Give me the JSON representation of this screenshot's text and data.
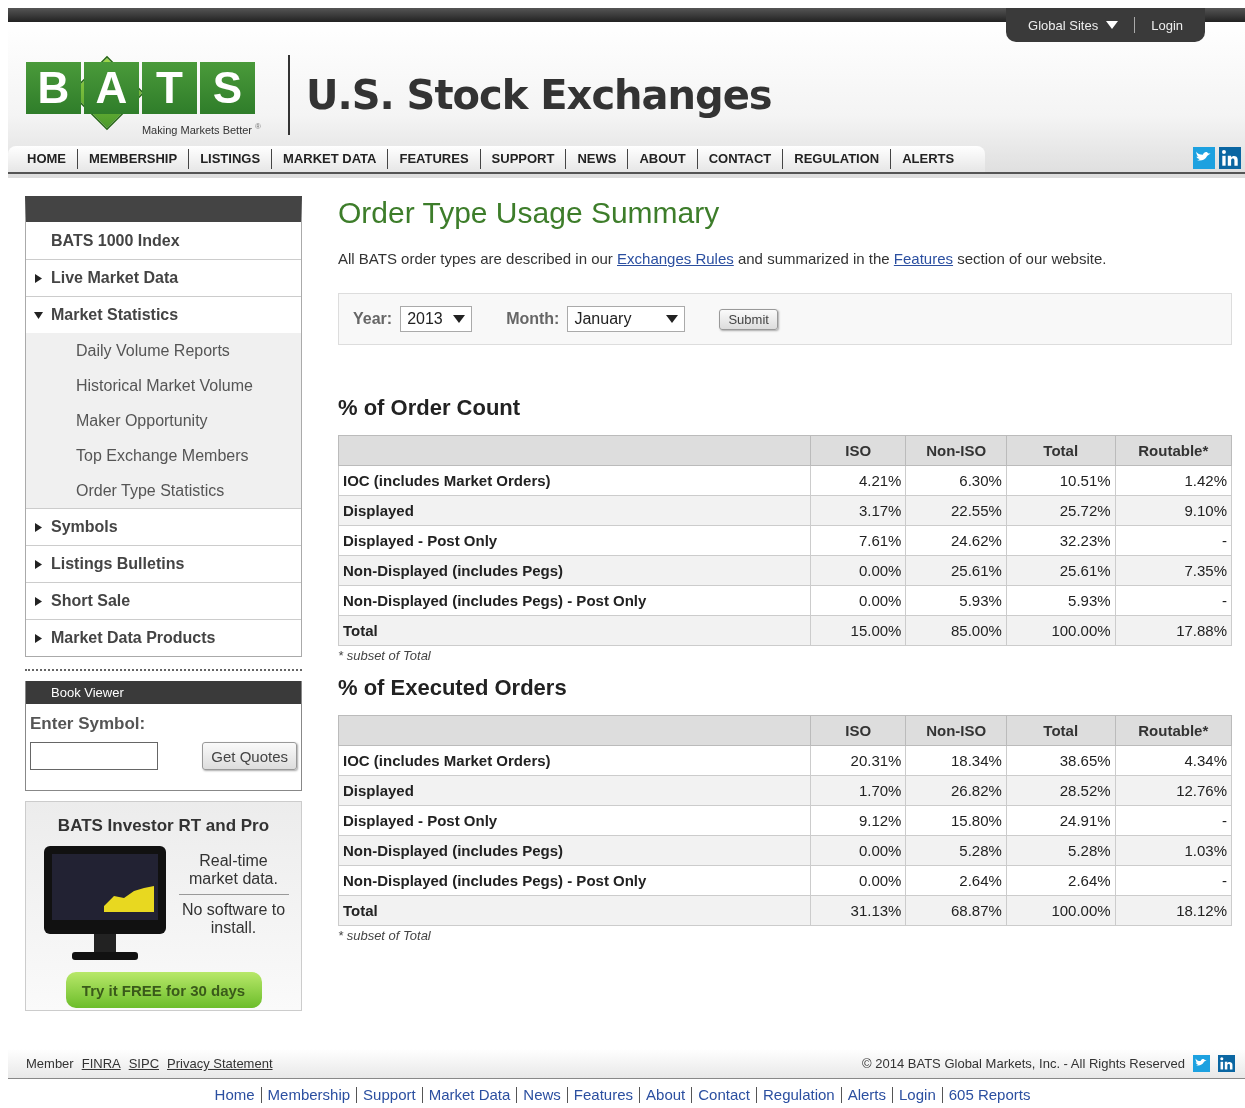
{
  "top_bar": {
    "links": [
      {
        "label": "Global Sites",
        "kind": "dropdown"
      },
      {
        "label": "Login",
        "kind": "link"
      }
    ]
  },
  "header": {
    "logo": {
      "letters": [
        "B",
        "A",
        "T",
        "S"
      ],
      "tagline": "Making Markets Better",
      "mark": "®"
    },
    "title": "U.S. Stock Exchanges"
  },
  "nav": {
    "items": [
      "HOME",
      "MEMBERSHIP",
      "LISTINGS",
      "MARKET DATA",
      "FEATURES",
      "SUPPORT",
      "NEWS",
      "ABOUT",
      "CONTACT",
      "REGULATION",
      "ALERTS"
    ]
  },
  "sidebar": {
    "items": [
      {
        "label": "BATS 1000 Index",
        "kind": "link"
      },
      {
        "label": "Live Market Data",
        "kind": "section",
        "expanded": false
      },
      {
        "label": "Market Statistics",
        "kind": "section",
        "expanded": true,
        "children": [
          {
            "label": "Daily Volume Reports"
          },
          {
            "label": "Historical Market Volume"
          },
          {
            "label": "Maker Opportunity"
          },
          {
            "label": "Top Exchange Members"
          },
          {
            "label": "Order Type Statistics"
          }
        ]
      },
      {
        "label": "Symbols",
        "kind": "section",
        "expanded": false
      },
      {
        "label": "Listings Bulletins",
        "kind": "section",
        "expanded": false
      },
      {
        "label": "Short Sale",
        "kind": "section",
        "expanded": false
      },
      {
        "label": "Market Data Products",
        "kind": "section",
        "expanded": false
      }
    ],
    "book_viewer": {
      "title": "Book Viewer",
      "label": "Enter Symbol:",
      "button": "Get Quotes"
    },
    "promo": {
      "title": "BATS Investor RT and Pro",
      "lines": [
        "Real-time market data.",
        "No software to install."
      ],
      "button": "Try it FREE for 30 days"
    }
  },
  "main": {
    "title": "Order Type Usage Summary",
    "intro": {
      "before": "All BATS order types are described in our ",
      "link1": "Exchanges Rules",
      "middle": " and summarized in the ",
      "link2": "Features",
      "after": " section of our website."
    },
    "filter": {
      "year_label": "Year:",
      "year": "2013",
      "month_label": "Month:",
      "month": "January",
      "button": "Submit"
    },
    "tables": [
      {
        "title": "% of Order Count",
        "columns": [
          "",
          "ISO",
          "Non-ISO",
          "Total",
          "Routable*"
        ],
        "rows": [
          [
            "IOC (includes Market Orders)",
            "4.21%",
            "6.30%",
            "10.51%",
            "1.42%"
          ],
          [
            "Displayed",
            "3.17%",
            "22.55%",
            "25.72%",
            "9.10%"
          ],
          [
            "Displayed - Post Only",
            "7.61%",
            "24.62%",
            "32.23%",
            "-"
          ],
          [
            "Non-Displayed (includes Pegs)",
            "0.00%",
            "25.61%",
            "25.61%",
            "7.35%"
          ],
          [
            "Non-Displayed (includes Pegs) - Post Only",
            "0.00%",
            "5.93%",
            "5.93%",
            "-"
          ],
          [
            "Total",
            "15.00%",
            "85.00%",
            "100.00%",
            "17.88%"
          ]
        ],
        "note": "* subset of Total"
      },
      {
        "title": "% of Executed Orders",
        "columns": [
          "",
          "ISO",
          "Non-ISO",
          "Total",
          "Routable*"
        ],
        "rows": [
          [
            "IOC (includes Market Orders)",
            "20.31%",
            "18.34%",
            "38.65%",
            "4.34%"
          ],
          [
            "Displayed",
            "1.70%",
            "26.82%",
            "28.52%",
            "12.76%"
          ],
          [
            "Displayed - Post Only",
            "9.12%",
            "15.80%",
            "24.91%",
            "-"
          ],
          [
            "Non-Displayed (includes Pegs)",
            "0.00%",
            "5.28%",
            "5.28%",
            "1.03%"
          ],
          [
            "Non-Displayed (includes Pegs) - Post Only",
            "0.00%",
            "2.64%",
            "2.64%",
            "-"
          ],
          [
            "Total",
            "31.13%",
            "68.87%",
            "100.00%",
            "18.12%"
          ]
        ],
        "note": "* subset of Total"
      }
    ]
  },
  "footer": {
    "member_label": "Member",
    "links": [
      "FINRA",
      "SIPC",
      "Privacy Statement"
    ],
    "copyright": "© 2014 BATS Global Markets, Inc. - All Rights Reserved",
    "bottom_links": [
      "Home",
      "Membership",
      "Support",
      "Market Data",
      "News",
      "Features",
      "About",
      "Contact",
      "Regulation",
      "Alerts",
      "Login",
      "605 Reports"
    ]
  }
}
